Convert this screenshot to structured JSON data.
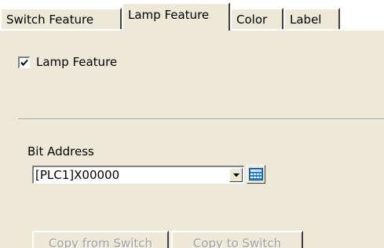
{
  "tabs": [
    {
      "label": "Switch Feature",
      "active": false
    },
    {
      "label": "Lamp Feature",
      "active": true
    },
    {
      "label": "Color",
      "active": false
    },
    {
      "label": "Label",
      "active": false
    }
  ],
  "lamp_feature": {
    "checkbox_label": "Lamp Feature",
    "checked": true
  },
  "bit_address": {
    "label": "Bit Address",
    "value": "[PLC1]X00000"
  },
  "buttons": {
    "copy_from_switch": "Copy from Switch",
    "copy_to_switch": "Copy to Switch",
    "enabled": false
  },
  "icons": {
    "check": "check-icon",
    "dropdown": "chevron-down-icon",
    "address_input": "keypad-icon"
  },
  "colors": {
    "panel": "#ece9d8",
    "disabled_text": "#a0a0a0",
    "keypad_blue": "#2a7fd4"
  }
}
